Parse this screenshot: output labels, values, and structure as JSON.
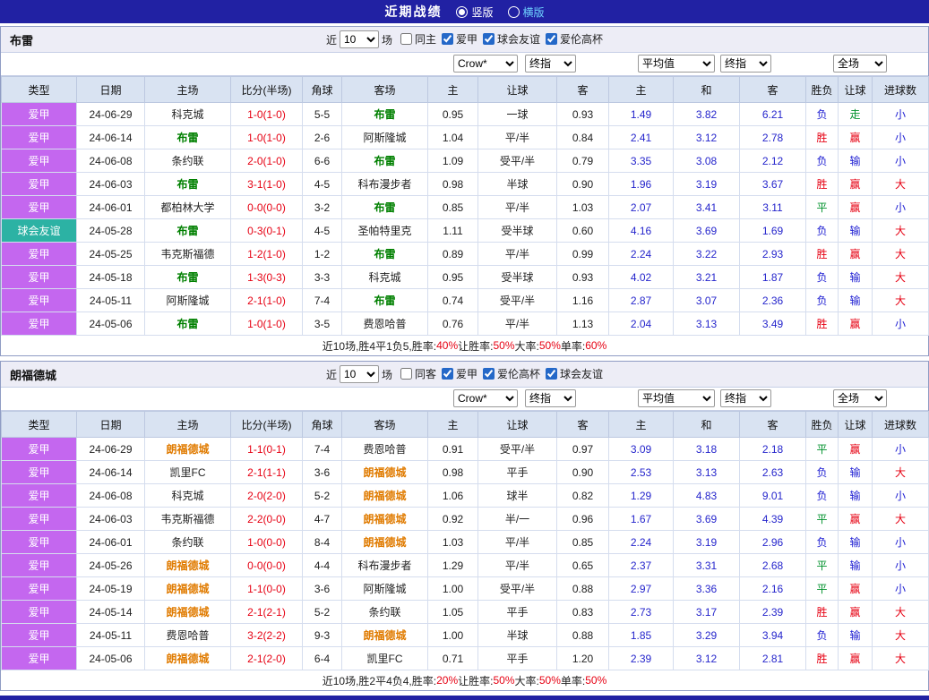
{
  "page": {
    "title": "近期战绩",
    "accent_color": "#2121a3",
    "view_options": [
      {
        "label": "竖版",
        "selected": true
      },
      {
        "label": "横版",
        "selected": false
      }
    ]
  },
  "sections": [
    {
      "team": "布雷",
      "team_color": "#008000",
      "filter": {
        "near_label": "近",
        "count": "10",
        "games_label": "场",
        "checkboxes": [
          {
            "label": "同主",
            "checked": false
          },
          {
            "label": "爱甲",
            "checked": true
          },
          {
            "label": "球会友谊",
            "checked": true
          },
          {
            "label": "爱伦高杯",
            "checked": true
          }
        ],
        "selects": {
          "company": "Crow*",
          "asia_type": "终指",
          "average": "平均值",
          "euro_type": "终指",
          "scope": "全场"
        }
      },
      "table": {
        "headers": [
          "类型",
          "日期",
          "主场",
          "比分(半场)",
          "角球",
          "客场",
          "主",
          "让球",
          "客",
          "主",
          "和",
          "客",
          "胜负",
          "让球",
          "进球数"
        ],
        "rows": [
          {
            "league": "爱甲",
            "league_color": "purple",
            "date": "24-06-29",
            "home": "科克城",
            "home_focus": false,
            "score": "1-0",
            "half": "(1-0)",
            "corner": "5-5",
            "away": "布雷",
            "away_focus": true,
            "asia_home": "0.95",
            "handicap": "一球",
            "asia_away": "0.93",
            "euro_home": "1.49",
            "euro_draw": "3.82",
            "euro_away": "6.21",
            "result": "负",
            "result_color": "blue",
            "handicap_result": "走",
            "handicap_result_color": "green",
            "goals": "小",
            "goals_color": "blue"
          },
          {
            "league": "爱甲",
            "league_color": "purple",
            "date": "24-06-14",
            "home": "布雷",
            "home_focus": true,
            "score": "1-0",
            "half": "(1-0)",
            "corner": "2-6",
            "away": "阿斯隆城",
            "away_focus": false,
            "asia_home": "1.04",
            "handicap": "平/半",
            "asia_away": "0.84",
            "euro_home": "2.41",
            "euro_draw": "3.12",
            "euro_away": "2.78",
            "result": "胜",
            "result_color": "red",
            "handicap_result": "赢",
            "handicap_result_color": "red",
            "goals": "小",
            "goals_color": "blue"
          },
          {
            "league": "爱甲",
            "league_color": "purple",
            "date": "24-06-08",
            "home": "条约联",
            "home_focus": false,
            "score": "2-0",
            "half": "(1-0)",
            "corner": "6-6",
            "away": "布雷",
            "away_focus": true,
            "asia_home": "1.09",
            "handicap": "受平/半",
            "asia_away": "0.79",
            "euro_home": "3.35",
            "euro_draw": "3.08",
            "euro_away": "2.12",
            "result": "负",
            "result_color": "blue",
            "handicap_result": "输",
            "handicap_result_color": "blue",
            "goals": "小",
            "goals_color": "blue"
          },
          {
            "league": "爱甲",
            "league_color": "purple",
            "date": "24-06-03",
            "home": "布雷",
            "home_focus": true,
            "score": "3-1",
            "half": "(1-0)",
            "corner": "4-5",
            "away": "科布漫步者",
            "away_focus": false,
            "asia_home": "0.98",
            "handicap": "半球",
            "asia_away": "0.90",
            "euro_home": "1.96",
            "euro_draw": "3.19",
            "euro_away": "3.67",
            "result": "胜",
            "result_color": "red",
            "handicap_result": "赢",
            "handicap_result_color": "red",
            "goals": "大",
            "goals_color": "red"
          },
          {
            "league": "爱甲",
            "league_color": "purple",
            "date": "24-06-01",
            "home": "都柏林大学",
            "home_focus": false,
            "score": "0-0",
            "half": "(0-0)",
            "corner": "3-2",
            "away": "布雷",
            "away_focus": true,
            "asia_home": "0.85",
            "handicap": "平/半",
            "asia_away": "1.03",
            "euro_home": "2.07",
            "euro_draw": "3.41",
            "euro_away": "3.11",
            "result": "平",
            "result_color": "green",
            "handicap_result": "赢",
            "handicap_result_color": "red",
            "goals": "小",
            "goals_color": "blue"
          },
          {
            "league": "球会友谊",
            "league_color": "teal",
            "date": "24-05-28",
            "home": "布雷",
            "home_focus": true,
            "score": "0-3",
            "half": "(0-1)",
            "corner": "4-5",
            "away": "圣帕特里克",
            "away_focus": false,
            "asia_home": "1.11",
            "handicap": "受半球",
            "asia_away": "0.60",
            "euro_home": "4.16",
            "euro_draw": "3.69",
            "euro_away": "1.69",
            "result": "负",
            "result_color": "blue",
            "handicap_result": "输",
            "handicap_result_color": "blue",
            "goals": "大",
            "goals_color": "red"
          },
          {
            "league": "爱甲",
            "league_color": "purple",
            "date": "24-05-25",
            "home": "韦克斯福德",
            "home_focus": false,
            "score": "1-2",
            "half": "(1-0)",
            "corner": "1-2",
            "away": "布雷",
            "away_focus": true,
            "asia_home": "0.89",
            "handicap": "平/半",
            "asia_away": "0.99",
            "euro_home": "2.24",
            "euro_draw": "3.22",
            "euro_away": "2.93",
            "result": "胜",
            "result_color": "red",
            "handicap_result": "赢",
            "handicap_result_color": "red",
            "goals": "大",
            "goals_color": "red"
          },
          {
            "league": "爱甲",
            "league_color": "purple",
            "date": "24-05-18",
            "home": "布雷",
            "home_focus": true,
            "score": "1-3",
            "half": "(0-3)",
            "corner": "3-3",
            "away": "科克城",
            "away_focus": false,
            "asia_home": "0.95",
            "handicap": "受半球",
            "asia_away": "0.93",
            "euro_home": "4.02",
            "euro_draw": "3.21",
            "euro_away": "1.87",
            "result": "负",
            "result_color": "blue",
            "handicap_result": "输",
            "handicap_result_color": "blue",
            "goals": "大",
            "goals_color": "red"
          },
          {
            "league": "爱甲",
            "league_color": "purple",
            "date": "24-05-11",
            "home": "阿斯隆城",
            "home_focus": false,
            "score": "2-1",
            "half": "(1-0)",
            "corner": "7-4",
            "away": "布雷",
            "away_focus": true,
            "asia_home": "0.74",
            "handicap": "受平/半",
            "asia_away": "1.16",
            "euro_home": "2.87",
            "euro_draw": "3.07",
            "euro_away": "2.36",
            "result": "负",
            "result_color": "blue",
            "handicap_result": "输",
            "handicap_result_color": "blue",
            "goals": "大",
            "goals_color": "red"
          },
          {
            "league": "爱甲",
            "league_color": "purple",
            "date": "24-05-06",
            "home": "布雷",
            "home_focus": true,
            "score": "1-0",
            "half": "(1-0)",
            "corner": "3-5",
            "away": "费恩哈普",
            "away_focus": false,
            "asia_home": "0.76",
            "handicap": "平/半",
            "asia_away": "1.13",
            "euro_home": "2.04",
            "euro_draw": "3.13",
            "euro_away": "3.49",
            "result": "胜",
            "result_color": "red",
            "handicap_result": "赢",
            "handicap_result_color": "red",
            "goals": "小",
            "goals_color": "blue"
          }
        ]
      },
      "summary": [
        {
          "text": "近10场,胜4平1负5, ",
          "red": false
        },
        {
          "text": "胜率:",
          "red": false
        },
        {
          "text": "40%",
          "red": true
        },
        {
          "text": " 让胜率:",
          "red": false
        },
        {
          "text": "50%",
          "red": true
        },
        {
          "text": " 大率:",
          "red": false
        },
        {
          "text": "50%",
          "red": true
        },
        {
          "text": " 单率:",
          "red": false
        },
        {
          "text": "60%",
          "red": true
        }
      ]
    },
    {
      "team": "朗福德城",
      "team_color": "#e07b00",
      "filter": {
        "near_label": "近",
        "count": "10",
        "games_label": "场",
        "checkboxes": [
          {
            "label": "同客",
            "checked": false
          },
          {
            "label": "爱甲",
            "checked": true
          },
          {
            "label": "爱伦高杯",
            "checked": true
          },
          {
            "label": "球会友谊",
            "checked": true
          }
        ],
        "selects": {
          "company": "Crow*",
          "asia_type": "终指",
          "average": "平均值",
          "euro_type": "终指",
          "scope": "全场"
        }
      },
      "table": {
        "headers": [
          "类型",
          "日期",
          "主场",
          "比分(半场)",
          "角球",
          "客场",
          "主",
          "让球",
          "客",
          "主",
          "和",
          "客",
          "胜负",
          "让球",
          "进球数"
        ],
        "rows": [
          {
            "league": "爱甲",
            "league_color": "purple",
            "date": "24-06-29",
            "home": "朗福德城",
            "home_focus": true,
            "score": "1-1",
            "half": "(0-1)",
            "corner": "7-4",
            "away": "费恩哈普",
            "away_focus": false,
            "asia_home": "0.91",
            "handicap": "受平/半",
            "asia_away": "0.97",
            "euro_home": "3.09",
            "euro_draw": "3.18",
            "euro_away": "2.18",
            "result": "平",
            "result_color": "green",
            "handicap_result": "赢",
            "handicap_result_color": "red",
            "goals": "小",
            "goals_color": "blue"
          },
          {
            "league": "爱甲",
            "league_color": "purple",
            "date": "24-06-14",
            "home": "凯里FC",
            "home_focus": false,
            "score": "2-1",
            "half": "(1-1)",
            "corner": "3-6",
            "away": "朗福德城",
            "away_focus": true,
            "asia_home": "0.98",
            "handicap": "平手",
            "asia_away": "0.90",
            "euro_home": "2.53",
            "euro_draw": "3.13",
            "euro_away": "2.63",
            "result": "负",
            "result_color": "blue",
            "handicap_result": "输",
            "handicap_result_color": "blue",
            "goals": "大",
            "goals_color": "red"
          },
          {
            "league": "爱甲",
            "league_color": "purple",
            "date": "24-06-08",
            "home": "科克城",
            "home_focus": false,
            "score": "2-0",
            "half": "(2-0)",
            "corner": "5-2",
            "away": "朗福德城",
            "away_focus": true,
            "asia_home": "1.06",
            "handicap": "球半",
            "asia_away": "0.82",
            "euro_home": "1.29",
            "euro_draw": "4.83",
            "euro_away": "9.01",
            "result": "负",
            "result_color": "blue",
            "handicap_result": "输",
            "handicap_result_color": "blue",
            "goals": "小",
            "goals_color": "blue"
          },
          {
            "league": "爱甲",
            "league_color": "purple",
            "date": "24-06-03",
            "home": "韦克斯福德",
            "home_focus": false,
            "score": "2-2",
            "half": "(0-0)",
            "corner": "4-7",
            "away": "朗福德城",
            "away_focus": true,
            "asia_home": "0.92",
            "handicap": "半/一",
            "asia_away": "0.96",
            "euro_home": "1.67",
            "euro_draw": "3.69",
            "euro_away": "4.39",
            "result": "平",
            "result_color": "green",
            "handicap_result": "赢",
            "handicap_result_color": "red",
            "goals": "大",
            "goals_color": "red"
          },
          {
            "league": "爱甲",
            "league_color": "purple",
            "date": "24-06-01",
            "home": "条约联",
            "home_focus": false,
            "score": "1-0",
            "half": "(0-0)",
            "corner": "8-4",
            "away": "朗福德城",
            "away_focus": true,
            "asia_home": "1.03",
            "handicap": "平/半",
            "asia_away": "0.85",
            "euro_home": "2.24",
            "euro_draw": "3.19",
            "euro_away": "2.96",
            "result": "负",
            "result_color": "blue",
            "handicap_result": "输",
            "handicap_result_color": "blue",
            "goals": "小",
            "goals_color": "blue"
          },
          {
            "league": "爱甲",
            "league_color": "purple",
            "date": "24-05-26",
            "home": "朗福德城",
            "home_focus": true,
            "score": "0-0",
            "half": "(0-0)",
            "corner": "4-4",
            "away": "科布漫步者",
            "away_focus": false,
            "asia_home": "1.29",
            "handicap": "平/半",
            "asia_away": "0.65",
            "euro_home": "2.37",
            "euro_draw": "3.31",
            "euro_away": "2.68",
            "result": "平",
            "result_color": "green",
            "handicap_result": "输",
            "handicap_result_color": "blue",
            "goals": "小",
            "goals_color": "blue"
          },
          {
            "league": "爱甲",
            "league_color": "purple",
            "date": "24-05-19",
            "home": "朗福德城",
            "home_focus": true,
            "score": "1-1",
            "half": "(0-0)",
            "corner": "3-6",
            "away": "阿斯隆城",
            "away_focus": false,
            "asia_home": "1.00",
            "handicap": "受平/半",
            "asia_away": "0.88",
            "euro_home": "2.97",
            "euro_draw": "3.36",
            "euro_away": "2.16",
            "result": "平",
            "result_color": "green",
            "handicap_result": "赢",
            "handicap_result_color": "red",
            "goals": "小",
            "goals_color": "blue"
          },
          {
            "league": "爱甲",
            "league_color": "purple",
            "date": "24-05-14",
            "home": "朗福德城",
            "home_focus": true,
            "score": "2-1",
            "half": "(2-1)",
            "corner": "5-2",
            "away": "条约联",
            "away_focus": false,
            "asia_home": "1.05",
            "handicap": "平手",
            "asia_away": "0.83",
            "euro_home": "2.73",
            "euro_draw": "3.17",
            "euro_away": "2.39",
            "result": "胜",
            "result_color": "red",
            "handicap_result": "赢",
            "handicap_result_color": "red",
            "goals": "大",
            "goals_color": "red"
          },
          {
            "league": "爱甲",
            "league_color": "purple",
            "date": "24-05-11",
            "home": "费恩哈普",
            "home_focus": false,
            "score": "3-2",
            "half": "(2-2)",
            "corner": "9-3",
            "away": "朗福德城",
            "away_focus": true,
            "asia_home": "1.00",
            "handicap": "半球",
            "asia_away": "0.88",
            "euro_home": "1.85",
            "euro_draw": "3.29",
            "euro_away": "3.94",
            "result": "负",
            "result_color": "blue",
            "handicap_result": "输",
            "handicap_result_color": "blue",
            "goals": "大",
            "goals_color": "red"
          },
          {
            "league": "爱甲",
            "league_color": "purple",
            "date": "24-05-06",
            "home": "朗福德城",
            "home_focus": true,
            "score": "2-1",
            "half": "(2-0)",
            "corner": "6-4",
            "away": "凯里FC",
            "away_focus": false,
            "asia_home": "0.71",
            "handicap": "平手",
            "asia_away": "1.20",
            "euro_home": "2.39",
            "euro_draw": "3.12",
            "euro_away": "2.81",
            "result": "胜",
            "result_color": "red",
            "handicap_result": "赢",
            "handicap_result_color": "red",
            "goals": "大",
            "goals_color": "red"
          }
        ]
      },
      "summary": [
        {
          "text": "近10场,胜2平4负4, ",
          "red": false
        },
        {
          "text": "胜率:",
          "red": false
        },
        {
          "text": "20%",
          "red": true
        },
        {
          "text": " 让胜率:",
          "red": false
        },
        {
          "text": "50%",
          "red": true
        },
        {
          "text": " 大率:",
          "red": false
        },
        {
          "text": "50%",
          "red": true
        },
        {
          "text": " 单率:",
          "red": false
        },
        {
          "text": "50%",
          "red": true
        }
      ]
    }
  ]
}
